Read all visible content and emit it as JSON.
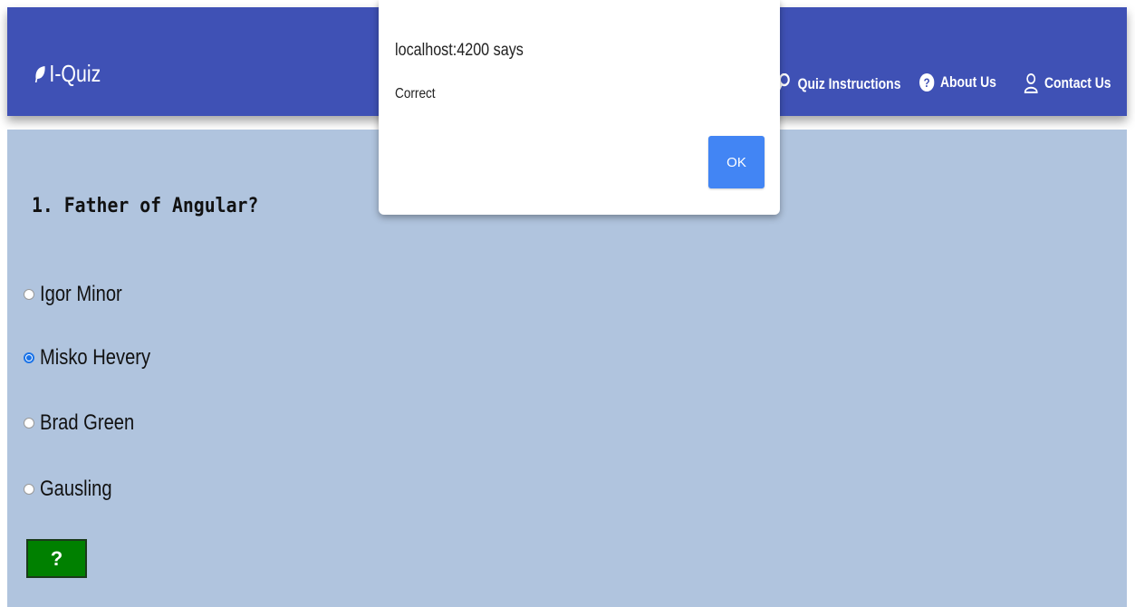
{
  "navbar": {
    "brand": "I-Quiz",
    "items": [
      {
        "label": "Quiz Instructions",
        "icon": "search-icon"
      },
      {
        "label": "About Us",
        "icon": "question-circle-icon"
      },
      {
        "label": "Contact Us",
        "icon": "user-icon"
      }
    ]
  },
  "quiz": {
    "question": "1. Father of Angular?",
    "options": [
      "Igor Minor",
      "Misko Hevery",
      "Brad Green",
      "Gausling"
    ],
    "selected_option": "Misko Hevery",
    "hint_label": "?"
  },
  "alert": {
    "title": "localhost:4200 says",
    "message": "Correct",
    "ok_label": "OK"
  },
  "colors": {
    "navbar": "#3f51b5",
    "content_bg": "#b0c4de",
    "hint_button": "#008000",
    "ok_button": "#4285f4"
  }
}
